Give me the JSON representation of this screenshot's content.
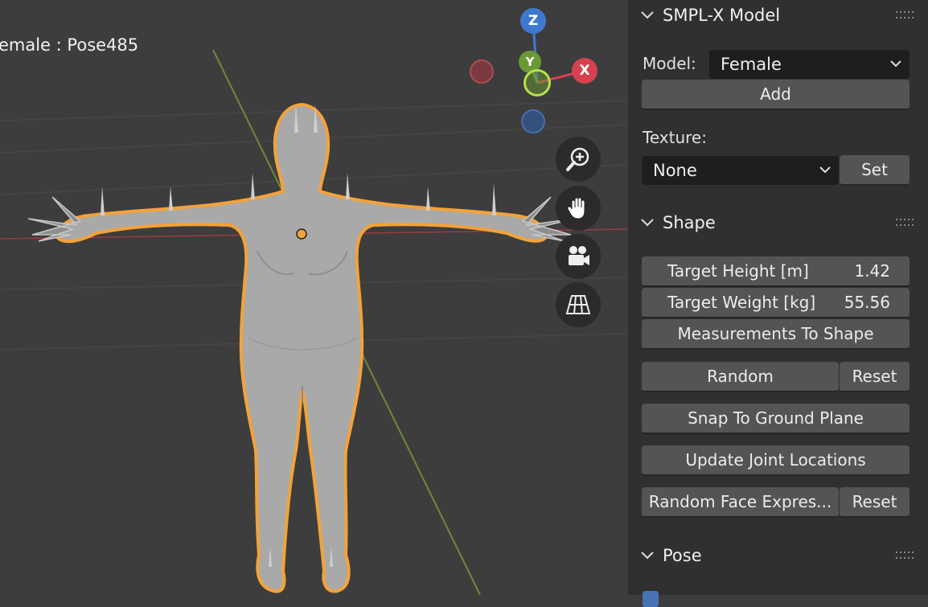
{
  "viewport": {
    "object_label": "emale : Pose485",
    "gizmo": {
      "z_label": "Z",
      "y_label": "Y",
      "x_label": "X",
      "colors": {
        "x": "#d6424f",
        "y": "#6a9a34",
        "z": "#3f78d0"
      }
    },
    "nav_buttons": [
      "zoom-icon",
      "hand-pan-icon",
      "camera-icon",
      "perspective-grid-icon"
    ],
    "selection_color": "#f4a23a"
  },
  "panel": {
    "smplx": {
      "title": "SMPL-X Model",
      "model_label": "Model:",
      "model_value": "Female",
      "add_label": "Add",
      "texture_label": "Texture:",
      "texture_value": "None",
      "set_label": "Set"
    },
    "shape": {
      "title": "Shape",
      "target_height_label": "Target Height [m]",
      "target_height_value": "1.42",
      "target_weight_label": "Target Weight [kg]",
      "target_weight_value": "55.56",
      "measurements_label": "Measurements To Shape",
      "random_label": "Random",
      "reset_label": "Reset",
      "snap_label": "Snap To Ground Plane",
      "update_joints_label": "Update Joint Locations",
      "random_face_label": "Random Face Expres...",
      "reset_face_label": "Reset"
    },
    "pose": {
      "title": "Pose"
    }
  }
}
